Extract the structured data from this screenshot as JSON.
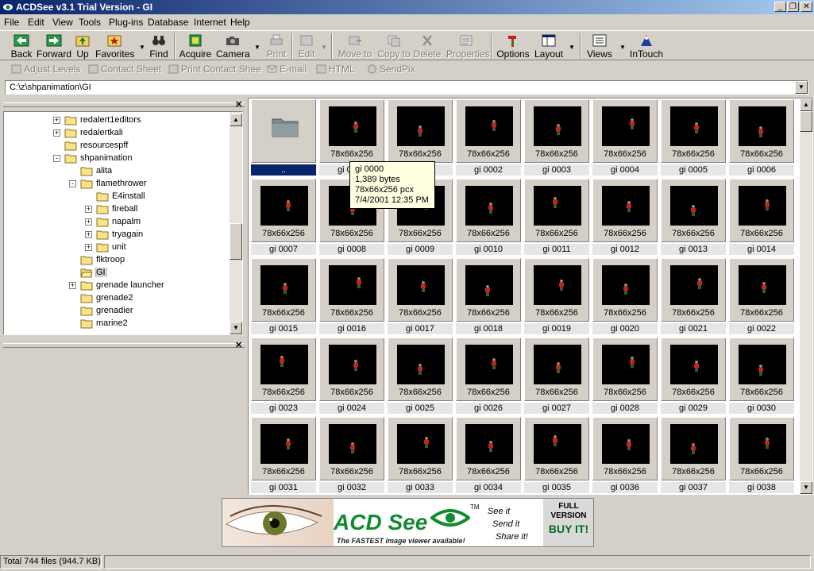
{
  "window": {
    "title": "ACDSee v3.1 Trial Version - GI"
  },
  "menu": [
    "File",
    "Edit",
    "View",
    "Tools",
    "Plug-ins",
    "Database",
    "Internet",
    "Help"
  ],
  "toolbar": {
    "back": "Back",
    "forward": "Forward",
    "up": "Up",
    "favorites": "Favorites",
    "find": "Find",
    "acquire": "Acquire",
    "camera": "Camera",
    "print": "Print",
    "edit": "Edit",
    "move_to": "Move to",
    "copy_to": "Copy to",
    "delete": "Delete",
    "properties": "Properties",
    "options": "Options",
    "layout": "Layout",
    "views": "Views",
    "intouch": "InTouch"
  },
  "toolbar2": {
    "adjust_levels": "Adjust Levels",
    "contact_sheet": "Contact Sheet",
    "print_contact_sheet": "Print Contact Shee",
    "email": "E-mail",
    "html": "HTML",
    "sendpix": "SendPix"
  },
  "address": {
    "path": "C:\\z\\shpanimation\\GI"
  },
  "tree": [
    {
      "label": "redalert1editors",
      "level": 0,
      "expander": "+"
    },
    {
      "label": "redalertkali",
      "level": 0,
      "expander": "+"
    },
    {
      "label": "resourcespff",
      "level": 0,
      "expander": ""
    },
    {
      "label": "shpanimation",
      "level": 0,
      "expander": "-"
    },
    {
      "label": "alita",
      "level": 1,
      "expander": ""
    },
    {
      "label": "flamethrower",
      "level": 1,
      "expander": "-"
    },
    {
      "label": "E4install",
      "level": 2,
      "expander": ""
    },
    {
      "label": "fireball",
      "level": 2,
      "expander": "+"
    },
    {
      "label": "napalm",
      "level": 2,
      "expander": "+"
    },
    {
      "label": "tryagain",
      "level": 2,
      "expander": "+"
    },
    {
      "label": "unit",
      "level": 2,
      "expander": "+"
    },
    {
      "label": "flktroop",
      "level": 1,
      "expander": ""
    },
    {
      "label": "GI",
      "level": 1,
      "expander": "",
      "selected": true
    },
    {
      "label": "grenade launcher",
      "level": 1,
      "expander": "+"
    },
    {
      "label": "grenade2",
      "level": 1,
      "expander": ""
    },
    {
      "label": "grenadier",
      "level": 1,
      "expander": ""
    },
    {
      "label": "marine2",
      "level": 1,
      "expander": ""
    }
  ],
  "files": {
    "parent_folder_caption": "..",
    "dimension_label": "78x66x256",
    "items": [
      "gi 0000",
      "gi 0001",
      "gi 0002",
      "gi 0003",
      "gi 0004",
      "gi 0005",
      "gi 0006",
      "gi 0007",
      "gi 0008",
      "gi 0009",
      "gi 0010",
      "gi 0011",
      "gi 0012",
      "gi 0013",
      "gi 0014",
      "gi 0015",
      "gi 0016",
      "gi 0017",
      "gi 0018",
      "gi 0019",
      "gi 0020",
      "gi 0021",
      "gi 0022",
      "gi 0023",
      "gi 0024",
      "gi 0025",
      "gi 0026",
      "gi 0027",
      "gi 0028",
      "gi 0029",
      "gi 0030",
      "gi 0031",
      "gi 0032",
      "gi 0033",
      "gi 0034",
      "gi 0035",
      "gi 0036",
      "gi 0037",
      "gi 0038"
    ]
  },
  "tooltip": {
    "name": "gi 0000",
    "size": "1,389 bytes",
    "dims": "78x66x256 pcx",
    "date": "7/4/2001 12:35 PM"
  },
  "ad": {
    "brand": "ACD See",
    "tm": "TM",
    "tagline": "The FASTEST image viewer available!",
    "slogan1": "See it",
    "slogan2": "Send it",
    "slogan3": "Share it!",
    "full": "FULL",
    "version": "VERSION",
    "buy": "BUY IT!"
  },
  "status": {
    "total": "Total 744 files (944.7 KB)"
  },
  "colors": {
    "title_start": "#0a246a",
    "title_end": "#a6caf0",
    "selection": "#0a246a",
    "brand_green": "#128a30"
  }
}
